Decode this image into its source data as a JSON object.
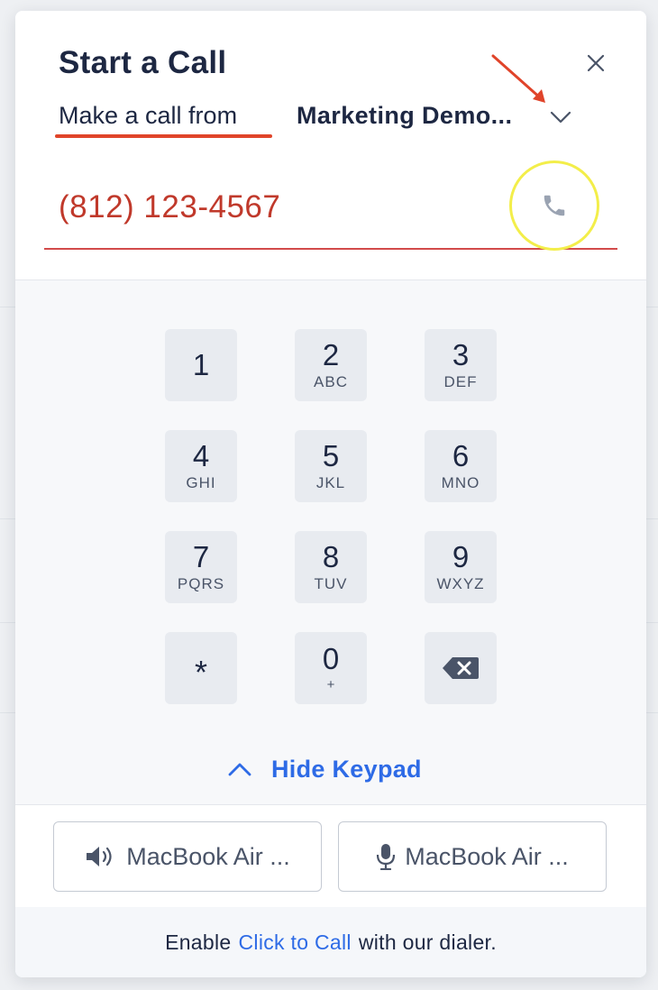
{
  "dialog": {
    "title": "Start a Call",
    "from_label": "Make a call from",
    "from_value": "Marketing Demo...",
    "phone_value": "(812) 123-4567",
    "close_icon": "close-icon",
    "call_icon": "phone-icon"
  },
  "keypad": {
    "keys": [
      {
        "digit": "1",
        "letters": ""
      },
      {
        "digit": "2",
        "letters": "ABC"
      },
      {
        "digit": "3",
        "letters": "DEF"
      },
      {
        "digit": "4",
        "letters": "GHI"
      },
      {
        "digit": "5",
        "letters": "JKL"
      },
      {
        "digit": "6",
        "letters": "MNO"
      },
      {
        "digit": "7",
        "letters": "PQRS"
      },
      {
        "digit": "8",
        "letters": "TUV"
      },
      {
        "digit": "9",
        "letters": "WXYZ"
      },
      {
        "digit": "*",
        "letters": ""
      },
      {
        "digit": "0",
        "letters": "+"
      },
      {
        "digit": "",
        "letters": "",
        "icon": "backspace-icon"
      }
    ],
    "hide_label": "Hide Keypad"
  },
  "devices": {
    "speaker_label": "MacBook Air ...",
    "mic_label": "MacBook Air ..."
  },
  "footer": {
    "prefix": "Enable",
    "link": "Click to Call",
    "suffix": "with our dialer."
  },
  "colors": {
    "accent": "#2e6be6",
    "phone_text": "#c0392b",
    "annotation_red": "#e0442a",
    "highlight_yellow": "#f3ee4a"
  }
}
